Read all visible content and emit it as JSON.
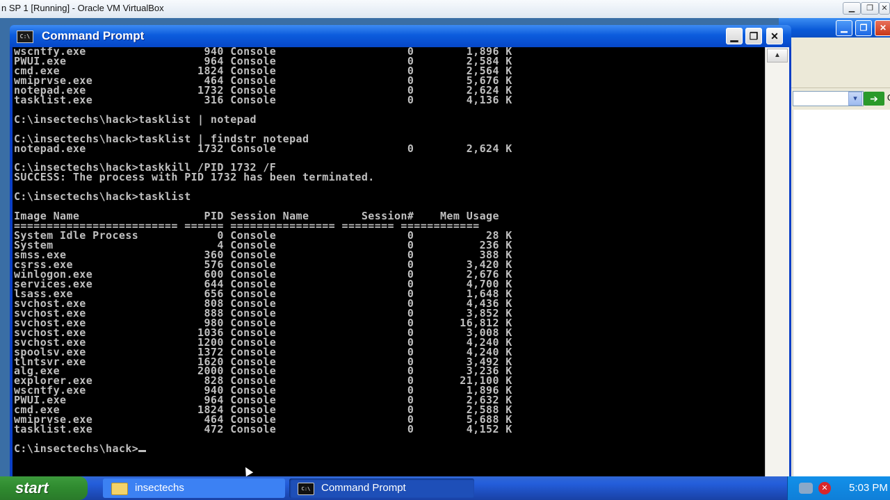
{
  "host": {
    "window_title": "n SP 1 [Running] - Oracle VM VirtualBox"
  },
  "cmd_window": {
    "title": "Command Prompt",
    "icon_text": "C:\\",
    "console_lines": [
      "wscntfy.exe                  940 Console                    0        1,896 K",
      "PWUI.exe                     964 Console                    0        2,584 K",
      "cmd.exe                     1824 Console                    0        2,564 K",
      "wmiprvse.exe                 464 Console                    0        5,676 K",
      "notepad.exe                 1732 Console                    0        2,624 K",
      "tasklist.exe                 316 Console                    0        4,136 K",
      "",
      "C:\\insectechs\\hack>tasklist | notepad",
      "",
      "C:\\insectechs\\hack>tasklist | findstr notepad",
      "notepad.exe                 1732 Console                    0        2,624 K",
      "",
      "C:\\insectechs\\hack>taskkill /PID 1732 /F",
      "SUCCESS: The process with PID 1732 has been terminated.",
      "",
      "C:\\insectechs\\hack>tasklist",
      "",
      "Image Name                   PID Session Name        Session#    Mem Usage",
      "========================= ====== ================ ======== ============",
      "System Idle Process            0 Console                    0           28 K",
      "System                         4 Console                    0          236 K",
      "smss.exe                     360 Console                    0          388 K",
      "csrss.exe                    576 Console                    0        3,420 K",
      "winlogon.exe                 600 Console                    0        2,676 K",
      "services.exe                 644 Console                    0        4,700 K",
      "lsass.exe                    656 Console                    0        1,648 K",
      "svchost.exe                  808 Console                    0        4,436 K",
      "svchost.exe                  888 Console                    0        3,852 K",
      "svchost.exe                  980 Console                    0       16,812 K",
      "svchost.exe                 1036 Console                    0        3,008 K",
      "svchost.exe                 1200 Console                    0        4,240 K",
      "spoolsv.exe                 1372 Console                    0        4,240 K",
      "tlntsvr.exe                 1620 Console                    0        3,492 K",
      "alg.exe                     2000 Console                    0        3,236 K",
      "explorer.exe                 828 Console                    0       21,100 K",
      "wscntfy.exe                  940 Console                    0        1,896 K",
      "PWUI.exe                     964 Console                    0        2,632 K",
      "cmd.exe                     1824 Console                    0        2,588 K",
      "wmiprvse.exe                 464 Console                    0        5,688 K",
      "tasklist.exe                 472 Console                    0        4,152 K",
      "",
      "C:\\insectechs\\hack>"
    ]
  },
  "background_window": {
    "go_label": "G"
  },
  "taskbar": {
    "start_label": "start",
    "tasks": [
      {
        "label": "insectechs",
        "icon": "folder-icon"
      },
      {
        "label": "Command Prompt",
        "icon": "cmd-icon"
      }
    ],
    "clock": "5:03 PM"
  },
  "colors": {
    "console_bg": "#000000",
    "console_fg": "#c0c0c0",
    "xp_titlebar": "#0a5ad8",
    "start_green": "#2f8a2f"
  }
}
